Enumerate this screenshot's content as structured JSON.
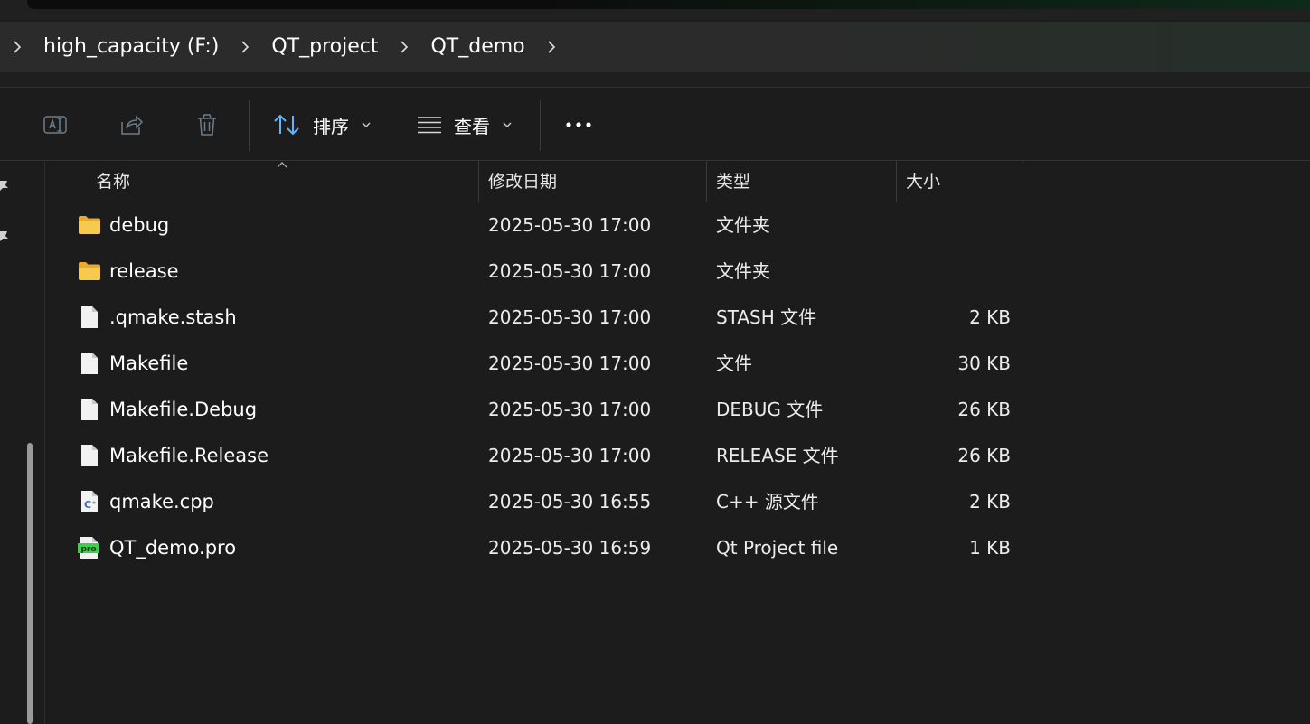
{
  "breadcrumb": {
    "items": [
      {
        "label": "high_capacity (F:)"
      },
      {
        "label": "QT_project"
      },
      {
        "label": "QT_demo"
      }
    ]
  },
  "toolbar": {
    "sort_label": "排序",
    "view_label": "查看",
    "icons": [
      "rename-icon",
      "share-icon",
      "delete-icon",
      "more-icon"
    ]
  },
  "columns": {
    "name": "名称",
    "modified": "修改日期",
    "type": "类型",
    "size": "大小"
  },
  "files": [
    {
      "name": "debug",
      "modified": "2025-05-30 17:00",
      "type": "文件夹",
      "size": "",
      "icon": "folder-icon"
    },
    {
      "name": "release",
      "modified": "2025-05-30 17:00",
      "type": "文件夹",
      "size": "",
      "icon": "folder-icon"
    },
    {
      "name": ".qmake.stash",
      "modified": "2025-05-30 17:00",
      "type": "STASH 文件",
      "size": "2 KB",
      "icon": "file-icon"
    },
    {
      "name": "Makefile",
      "modified": "2025-05-30 17:00",
      "type": "文件",
      "size": "30 KB",
      "icon": "file-icon"
    },
    {
      "name": "Makefile.Debug",
      "modified": "2025-05-30 17:00",
      "type": "DEBUG 文件",
      "size": "26 KB",
      "icon": "file-icon"
    },
    {
      "name": "Makefile.Release",
      "modified": "2025-05-30 17:00",
      "type": "RELEASE 文件",
      "size": "26 KB",
      "icon": "file-icon"
    },
    {
      "name": "qmake.cpp",
      "modified": "2025-05-30 16:55",
      "type": "C++ 源文件",
      "size": "2 KB",
      "icon": "cpp-file-icon"
    },
    {
      "name": "QT_demo.pro",
      "modified": "2025-05-30 16:59",
      "type": "Qt Project file",
      "size": "1 KB",
      "icon": "pro-file-icon"
    }
  ],
  "icon_texts": {
    "cpp": "C",
    "pro": "pro"
  },
  "colors": {
    "background": "#1c1c1c",
    "address_bar": "#2b2b2b",
    "folder": "#f4c44e",
    "accent": "#60b4ff"
  }
}
